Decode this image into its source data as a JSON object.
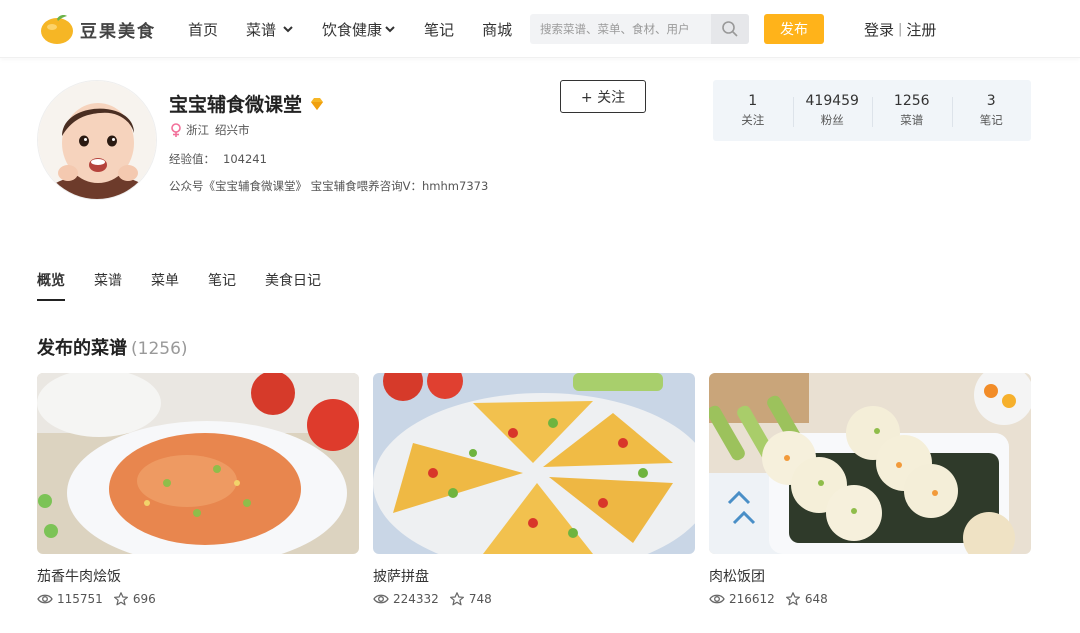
{
  "brand": {
    "name": "豆果美食",
    "color": "#ffb31a"
  },
  "nav": {
    "items": [
      {
        "label": "首页",
        "dropdown": false
      },
      {
        "label": "菜谱",
        "dropdown": true
      },
      {
        "label": "饮食健康",
        "dropdown": true
      },
      {
        "label": "笔记",
        "dropdown": false
      },
      {
        "label": "商城",
        "dropdown": false
      }
    ]
  },
  "search": {
    "placeholder": "搜索菜谱、菜单、食材、用户",
    "value": ""
  },
  "header": {
    "publish_label": "发布",
    "login_label": "登录",
    "register_label": "注册",
    "separator": "|"
  },
  "profile": {
    "name": "宝宝辅食微课堂",
    "province": "浙江",
    "city": "绍兴市",
    "exp_label": "经验值：",
    "exp_value": "104241",
    "bio": "公众号《宝宝辅食微课堂》 宝宝辅食喂养咨询V：hmhm7373",
    "follow_label": "+ 关注"
  },
  "stats": [
    {
      "value": "1",
      "label": "关注"
    },
    {
      "value": "419459",
      "label": "粉丝"
    },
    {
      "value": "1256",
      "label": "菜谱"
    },
    {
      "value": "3",
      "label": "笔记"
    }
  ],
  "tabs": [
    {
      "label": "概览",
      "active": true
    },
    {
      "label": "菜谱",
      "active": false
    },
    {
      "label": "菜单",
      "active": false
    },
    {
      "label": "笔记",
      "active": false
    },
    {
      "label": "美食日记",
      "active": false
    }
  ],
  "section": {
    "title": "发布的菜谱",
    "count": "(1256)"
  },
  "recipes": [
    {
      "title": "茄香牛肉烩饭",
      "views": "115751",
      "likes": "696"
    },
    {
      "title": "披萨拼盘",
      "views": "224332",
      "likes": "748"
    },
    {
      "title": "肉松饭团",
      "views": "216612",
      "likes": "648"
    }
  ]
}
